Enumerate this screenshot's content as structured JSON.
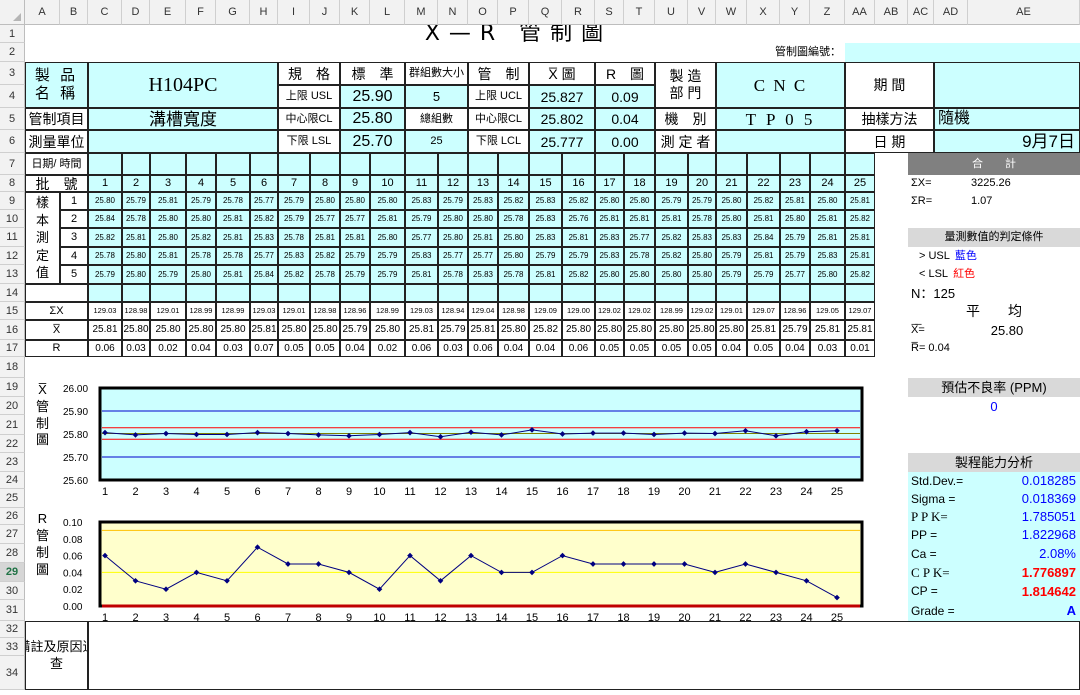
{
  "columns": [
    "A",
    "B",
    "C",
    "D",
    "E",
    "F",
    "G",
    "H",
    "I",
    "J",
    "K",
    "L",
    "M",
    "N",
    "O",
    "P",
    "Q",
    "R",
    "S",
    "T",
    "U",
    "V",
    "W",
    "X",
    "Y",
    "Z",
    "AA",
    "AB",
    "AC",
    "AD",
    "AE"
  ],
  "rows": [
    "1",
    "2",
    "3",
    "4",
    "5",
    "6",
    "7",
    "8",
    "9",
    "10",
    "11",
    "12",
    "13",
    "14",
    "15",
    "16",
    "17",
    "18",
    "19",
    "20",
    "21",
    "22",
    "23",
    "24",
    "25",
    "26",
    "27",
    "28",
    "29",
    "30",
    "31",
    "32",
    "33",
    "34"
  ],
  "selected_row": "29",
  "header": {
    "title": "X̅ — R　管 制 圖",
    "chart_no_label": "管制圖編號：",
    "product_name_label": "製 品\n名 稱",
    "product_name": "H104PC",
    "spec_label": "規　格",
    "std_label": "標　準",
    "subgroup_size_label": "群組數大小",
    "control_label": "管　制",
    "xbar_chart_label": "X̅ 圖",
    "r_chart_label": "R　圖",
    "dept_label": "製 造\n部 門",
    "dept_value": "C N C",
    "period_label": "期 間",
    "usl_label": "上限 USL",
    "usl": "25.90",
    "subgroup_size": "5",
    "ucl_label": "上限 UCL",
    "ucl_x": "25.827",
    "ucl_r": "0.09",
    "item_label": "管制項目",
    "item_value": "溝槽寬度",
    "cl_spec_label": "中心限CL",
    "cl_spec": "25.80",
    "total_groups_label": "總組數",
    "cl_label": "中心限CL",
    "cl_x": "25.802",
    "cl_r": "0.04",
    "machine_label": "機　別",
    "machine_value": "T P 0 5",
    "sampling_label": "抽樣方法",
    "sampling_value": "隨機",
    "unit_label": "測量單位",
    "lsl_label": "下限 LSL",
    "lsl": "25.70",
    "total_groups": "25",
    "lcl_label": "下限 LCL",
    "lcl_x": "25.777",
    "lcl_r": "0.00",
    "measurer_label": "測 定 者",
    "date_label": "日 期",
    "date_value": "9月7日"
  },
  "table": {
    "datetime_label": "日期/ 時間",
    "batch_label": "批　號",
    "sample_label": "樣\n本\n測\n定\n值",
    "sum_x_label": "ΣX",
    "xbar_label": "X̅",
    "r_label": "R",
    "batches": [
      "1",
      "2",
      "3",
      "4",
      "5",
      "6",
      "7",
      "8",
      "9",
      "10",
      "11",
      "12",
      "13",
      "14",
      "15",
      "16",
      "17",
      "18",
      "19",
      "20",
      "21",
      "22",
      "23",
      "24",
      "25"
    ],
    "sample_rows": [
      "1",
      "2",
      "3",
      "4",
      "5"
    ],
    "samples": [
      [
        "25.80",
        "25.79",
        "25.81",
        "25.79",
        "25.78",
        "25.77",
        "25.79",
        "25.80",
        "25.80",
        "25.80",
        "25.83",
        "25.79",
        "25.83",
        "25.82",
        "25.83",
        "25.82",
        "25.80",
        "25.80",
        "25.79",
        "25.79",
        "25.80",
        "25.82",
        "25.81",
        "25.80",
        "25.81"
      ],
      [
        "25.84",
        "25.78",
        "25.80",
        "25.80",
        "25.81",
        "25.82",
        "25.79",
        "25.77",
        "25.77",
        "25.81",
        "25.79",
        "25.80",
        "25.80",
        "25.78",
        "25.83",
        "25.76",
        "25.81",
        "25.81",
        "25.81",
        "25.78",
        "25.80",
        "25.81",
        "25.80",
        "25.81",
        "25.82"
      ],
      [
        "25.82",
        "25.81",
        "25.80",
        "25.82",
        "25.81",
        "25.83",
        "25.78",
        "25.81",
        "25.81",
        "25.80",
        "25.77",
        "25.80",
        "25.81",
        "25.80",
        "25.83",
        "25.81",
        "25.83",
        "25.77",
        "25.82",
        "25.83",
        "25.83",
        "25.84",
        "25.79",
        "25.81",
        "25.81"
      ],
      [
        "25.78",
        "25.80",
        "25.81",
        "25.78",
        "25.78",
        "25.77",
        "25.83",
        "25.82",
        "25.79",
        "25.79",
        "25.83",
        "25.77",
        "25.77",
        "25.80",
        "25.79",
        "25.79",
        "25.83",
        "25.78",
        "25.82",
        "25.80",
        "25.79",
        "25.81",
        "25.79",
        "25.83",
        "25.81"
      ],
      [
        "25.79",
        "25.80",
        "25.79",
        "25.80",
        "25.81",
        "25.84",
        "25.82",
        "25.78",
        "25.79",
        "25.79",
        "25.81",
        "25.78",
        "25.83",
        "25.78",
        "25.81",
        "25.82",
        "25.80",
        "25.80",
        "25.80",
        "25.80",
        "25.79",
        "25.79",
        "25.77",
        "25.80",
        "25.82"
      ]
    ],
    "sum_x": [
      "129.03",
      "128.98",
      "129.01",
      "128.99",
      "128.99",
      "129.03",
      "129.01",
      "128.98",
      "128.96",
      "128.99",
      "129.03",
      "128.94",
      "129.04",
      "128.98",
      "129.09",
      "129.00",
      "129.02",
      "129.02",
      "128.99",
      "129.02",
      "129.01",
      "129.07",
      "128.96",
      "129.05",
      "129.07"
    ],
    "xbar": [
      "25.81",
      "25.80",
      "25.80",
      "25.80",
      "25.80",
      "25.81",
      "25.80",
      "25.80",
      "25.79",
      "25.80",
      "25.81",
      "25.79",
      "25.81",
      "25.80",
      "25.82",
      "25.80",
      "25.80",
      "25.80",
      "25.80",
      "25.80",
      "25.80",
      "25.81",
      "25.79",
      "25.81",
      "25.81"
    ],
    "r": [
      "0.06",
      "0.03",
      "0.02",
      "0.04",
      "0.03",
      "0.07",
      "0.05",
      "0.05",
      "0.04",
      "0.02",
      "0.06",
      "0.03",
      "0.06",
      "0.04",
      "0.04",
      "0.06",
      "0.05",
      "0.05",
      "0.05",
      "0.05",
      "0.04",
      "0.05",
      "0.04",
      "0.03",
      "0.01"
    ]
  },
  "summary": {
    "total_label": "合　　計",
    "sum_x_label": "ΣX=",
    "sum_x_value": "3225.26",
    "sum_r_label": "ΣR=",
    "sum_r_value": "1.07",
    "criteria_label": "量測數值的判定條件",
    "usl_rule": "> USL",
    "usl_rule_color": "藍色",
    "lsl_rule": "< LSL",
    "lsl_rule_color": "紅色",
    "n_label": "N：125",
    "avg_label": "平　　均",
    "xbarbar_label": "X̅̅=",
    "xbarbar_value": "25.80",
    "rbar_label": "R̅= 0.04",
    "ppm_label": "預估不良率 (PPM)",
    "ppm_value": "0",
    "capability_label": "製程能力分析",
    "stats": [
      {
        "label": "Std.Dev.=",
        "value": "0.018285",
        "color": "#0000ff"
      },
      {
        "label": "Sigma =",
        "value": "0.018369",
        "color": "#0000ff"
      },
      {
        "label": "P P K=",
        "value": "1.785051",
        "color": "#0000ff"
      },
      {
        "label": "PP =",
        "value": "1.822968",
        "color": "#0000ff"
      },
      {
        "label": "Ca =",
        "value": "2.08%",
        "color": "#0000ff"
      },
      {
        "label": "C P K=",
        "value": "1.776897",
        "color": "#ff0000"
      },
      {
        "label": "CP =",
        "value": "1.814642",
        "color": "#ff0000"
      },
      {
        "label": "Grade =",
        "value": "A",
        "color": "#0000ff"
      }
    ]
  },
  "remarks_label": "備註及原因追\n查",
  "chart_labels": {
    "xbar_side": "X̅\n管\n制\n圖",
    "r_side": "R\n管\n制\n圖"
  },
  "chart_data": [
    {
      "type": "line",
      "title": "",
      "categories": [
        "1",
        "2",
        "3",
        "4",
        "5",
        "6",
        "7",
        "8",
        "9",
        "10",
        "11",
        "12",
        "13",
        "14",
        "15",
        "16",
        "17",
        "18",
        "19",
        "20",
        "21",
        "22",
        "23",
        "24",
        "25"
      ],
      "values": [
        25.806,
        25.796,
        25.802,
        25.798,
        25.798,
        25.806,
        25.802,
        25.796,
        25.792,
        25.798,
        25.806,
        25.788,
        25.808,
        25.796,
        25.818,
        25.8,
        25.804,
        25.804,
        25.798,
        25.804,
        25.802,
        25.814,
        25.792,
        25.81,
        25.814
      ],
      "ylim": [
        25.6,
        26.0
      ],
      "yticks": [
        "26.00",
        "25.90",
        "25.80",
        "25.70",
        "25.60"
      ],
      "limits": {
        "usl": 25.9,
        "ucl": 25.827,
        "cl": 25.802,
        "lcl": 25.777,
        "lsl": 25.7
      },
      "colors": {
        "background": "#ccffff",
        "spec_line": "#0000cc",
        "control_line": "#ff0000",
        "series": "#000080"
      }
    },
    {
      "type": "line",
      "title": "",
      "categories": [
        "1",
        "2",
        "3",
        "4",
        "5",
        "6",
        "7",
        "8",
        "9",
        "10",
        "11",
        "12",
        "13",
        "14",
        "15",
        "16",
        "17",
        "18",
        "19",
        "20",
        "21",
        "22",
        "23",
        "24",
        "25"
      ],
      "values": [
        0.06,
        0.03,
        0.02,
        0.04,
        0.03,
        0.07,
        0.05,
        0.05,
        0.04,
        0.02,
        0.06,
        0.03,
        0.06,
        0.04,
        0.04,
        0.06,
        0.05,
        0.05,
        0.05,
        0.05,
        0.04,
        0.05,
        0.04,
        0.03,
        0.01
      ],
      "ylim": [
        0.0,
        0.1
      ],
      "yticks": [
        "0.10",
        "0.08",
        "0.06",
        "0.04",
        "0.02",
        "0.00"
      ],
      "limits": {
        "ucl": 0.09,
        "cl": 0.04,
        "lcl": 0.0
      },
      "colors": {
        "background": "#ffffcc",
        "ucl_line": "#ffc000",
        "cl_line": "#ffff00",
        "lcl_line": "#c00000",
        "series": "#000080"
      }
    }
  ]
}
